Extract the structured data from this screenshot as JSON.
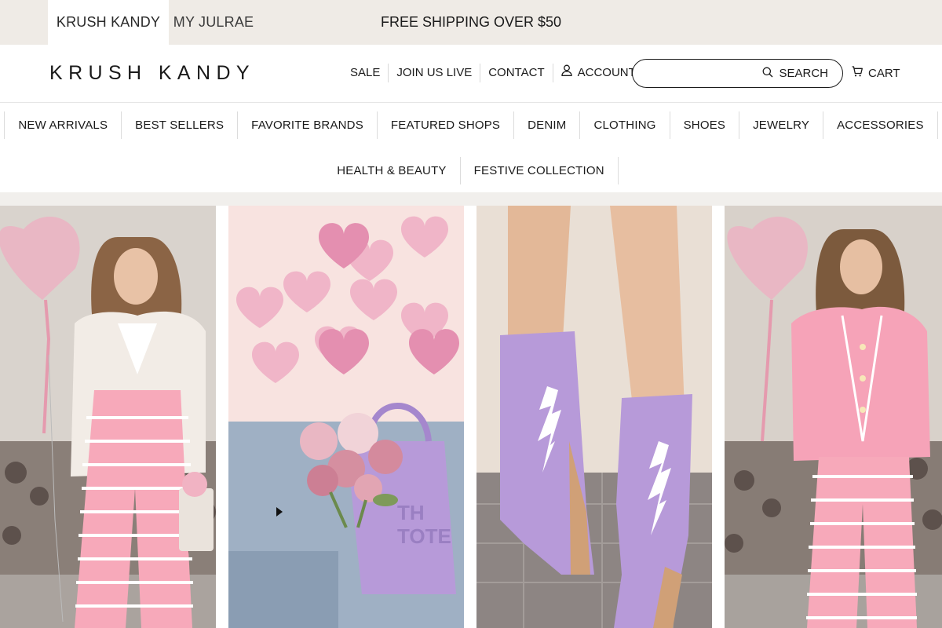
{
  "topbar": {
    "store_tabs": [
      {
        "label": "KRUSH KANDY",
        "active": true
      },
      {
        "label": "MY JULRAE",
        "active": false
      }
    ],
    "announcement": "FREE SHIPPING OVER $50"
  },
  "header": {
    "logo": "KRUSH KANDY",
    "links": {
      "sale": "SALE",
      "live": "JOIN US LIVE",
      "contact": "CONTACT",
      "account": "ACCOUNT"
    },
    "search": {
      "placeholder": "",
      "button_label": "SEARCH"
    },
    "cart_label": "CART"
  },
  "main_nav": {
    "row1": [
      "NEW ARRIVALS",
      "BEST SELLERS",
      "FAVORITE BRANDS",
      "FEATURED SHOPS",
      "DENIM",
      "CLOTHING",
      "SHOES",
      "JEWELRY",
      "ACCESSORIES"
    ],
    "row2": [
      "HEALTH & BEAUTY",
      "FESTIVE COLLECTION"
    ]
  },
  "hero": {
    "photo_2_text": "THE TOTE",
    "icons": {
      "account": "user-icon",
      "search": "magnifier-icon",
      "cart": "cart-icon",
      "media": "play-icon"
    },
    "colors": {
      "topbar_bg": "#efebe6",
      "pink": "#f4a6b8",
      "lavender": "#b79ad9",
      "balloon": "#e9b7c4"
    }
  }
}
